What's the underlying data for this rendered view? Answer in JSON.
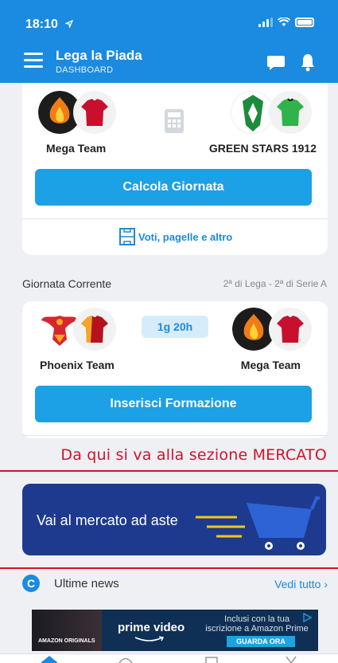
{
  "status": {
    "time": "18:10"
  },
  "header": {
    "title": "Lega la Piada",
    "subtitle": "DASHBOARD"
  },
  "prev_match": {
    "home_team": "Mega Team",
    "away_team": "GREEN STARS 1912",
    "button": "Calcola Giornata",
    "link": "Voti, pagelle e altro"
  },
  "current": {
    "label": "Giornata Corrente",
    "meta": "2ª di Lega - 2ª di Serie A",
    "home_team": "Phoenix Team",
    "away_team": "Mega Team",
    "countdown": "1g 20h",
    "button": "Inserisci Formazione"
  },
  "annotation": "Da qui si va alla sezione MERCATO",
  "market": {
    "label": "Vai al mercato ad aste"
  },
  "news": {
    "title": "Ultime news",
    "more": "Vedi tutto ›",
    "icon": "C"
  },
  "ad": {
    "brand": "prime video",
    "copy": "Inclusi con la tua iscrizione a Amazon Prime",
    "cta": "GUARDA ORA",
    "originals": "AMAZON ORIGINALS"
  },
  "colors": {
    "primary": "#1a8be0",
    "button": "#1ca0e6",
    "market_bg": "#1e3a8e",
    "annotation": "#d0142a"
  },
  "icons": [
    "menu-icon",
    "chat-icon",
    "bell-icon",
    "calculator-icon",
    "formation-icon",
    "cart-icon",
    "home-tab-icon"
  ]
}
